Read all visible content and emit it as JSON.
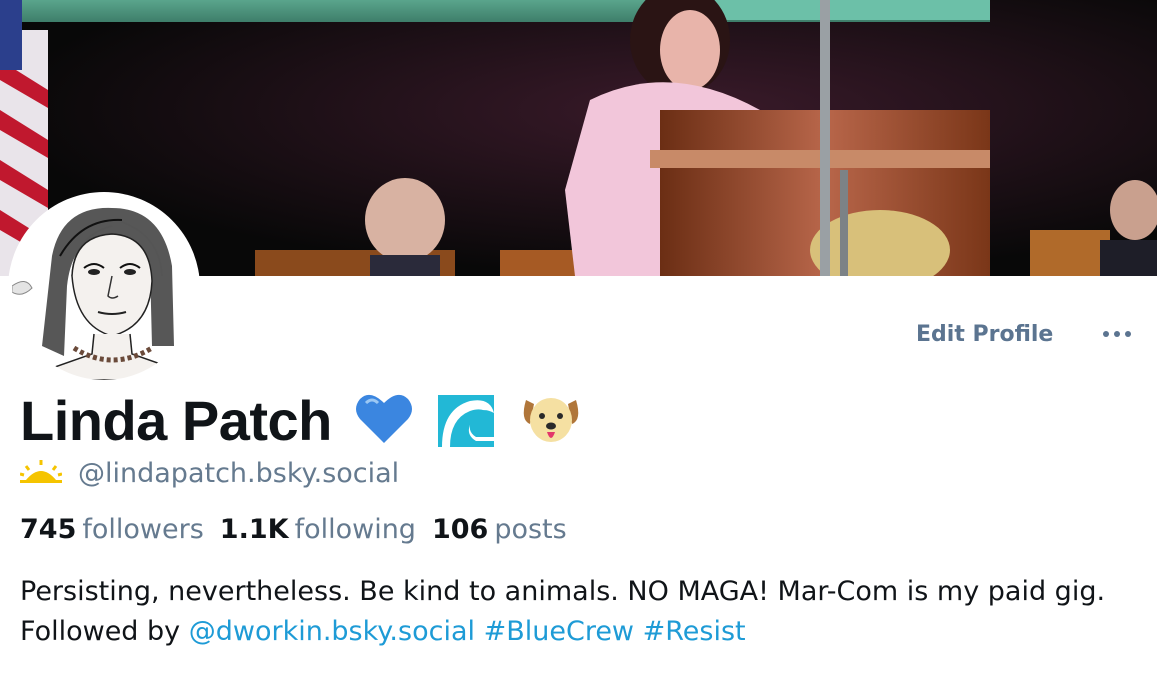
{
  "profile": {
    "display_name": "Linda Patch",
    "name_emojis": [
      "blue-heart-icon",
      "wave-icon",
      "dog-face-icon"
    ],
    "handle": "@lindapatch.bsky.social",
    "handle_badge_icon": "sun-icon",
    "actions": {
      "edit_label": "Edit Profile",
      "more_label": "···"
    },
    "stats": {
      "followers_count": "745",
      "followers_label": "followers",
      "following_count": "1.1K",
      "following_label": "following",
      "posts_count": "106",
      "posts_label": "posts"
    },
    "bio": {
      "text_line": "Persisting, nevertheless. Be kind to animals. NO MAGA! Mar-Com is my paid gig. Followed by",
      "mention": "@dworkin.bsky.social",
      "hashtag_1": "#BlueCrew",
      "hashtag_2": "#Resist"
    }
  },
  "colors": {
    "link": "#1e9bd6",
    "muted": "#657a8f",
    "text": "#101418",
    "button_text": "#5b7490"
  }
}
